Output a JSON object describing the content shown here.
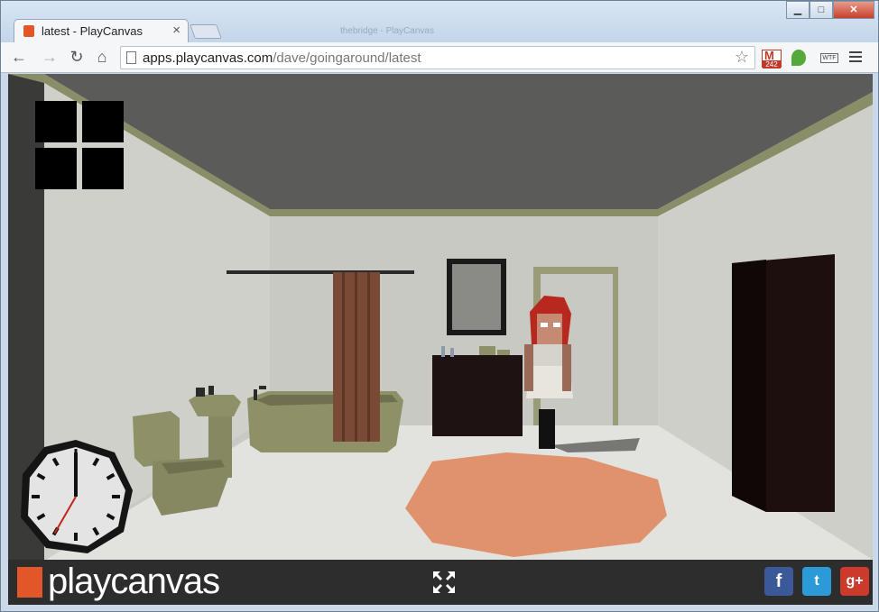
{
  "browser": {
    "tab_title": "latest - PlayCanvas",
    "tab_close": "×",
    "ghost_tab_title": "thebridge - PlayCanvas",
    "window_buttons": {
      "minimize": "▁",
      "maximize": "□",
      "close": "✕"
    },
    "nav": {
      "back": "←",
      "forward": "→",
      "reload": "↻",
      "home": "⌂"
    },
    "url_host": "apps.playcanvas.com",
    "url_path": "/dave/goingaround/latest",
    "star": "☆",
    "gmail_letter": "M",
    "gmail_count": "242",
    "wtf_label": "WTF"
  },
  "game": {
    "clock": {
      "hour_hand_angle_deg": 0,
      "minute_hand_angle_deg": 0,
      "second_hand_angle_deg": 210
    },
    "scene_colors": {
      "ceiling": "#5a5a58",
      "walls": "#cfcfca",
      "floor": "#dcdcd8",
      "trim": "#8a8e68",
      "rug": "#e0926c",
      "wardrobe": "#1c0f0d",
      "cabinet": "#1e1212",
      "curtain": "#7a4a36",
      "fixtures": "#8e9068"
    }
  },
  "footer": {
    "logo_text": "playcanvas",
    "fullscreen_icon": "fullscreen-icon",
    "social": {
      "facebook": "f",
      "twitter": "t",
      "google": "g+"
    }
  }
}
